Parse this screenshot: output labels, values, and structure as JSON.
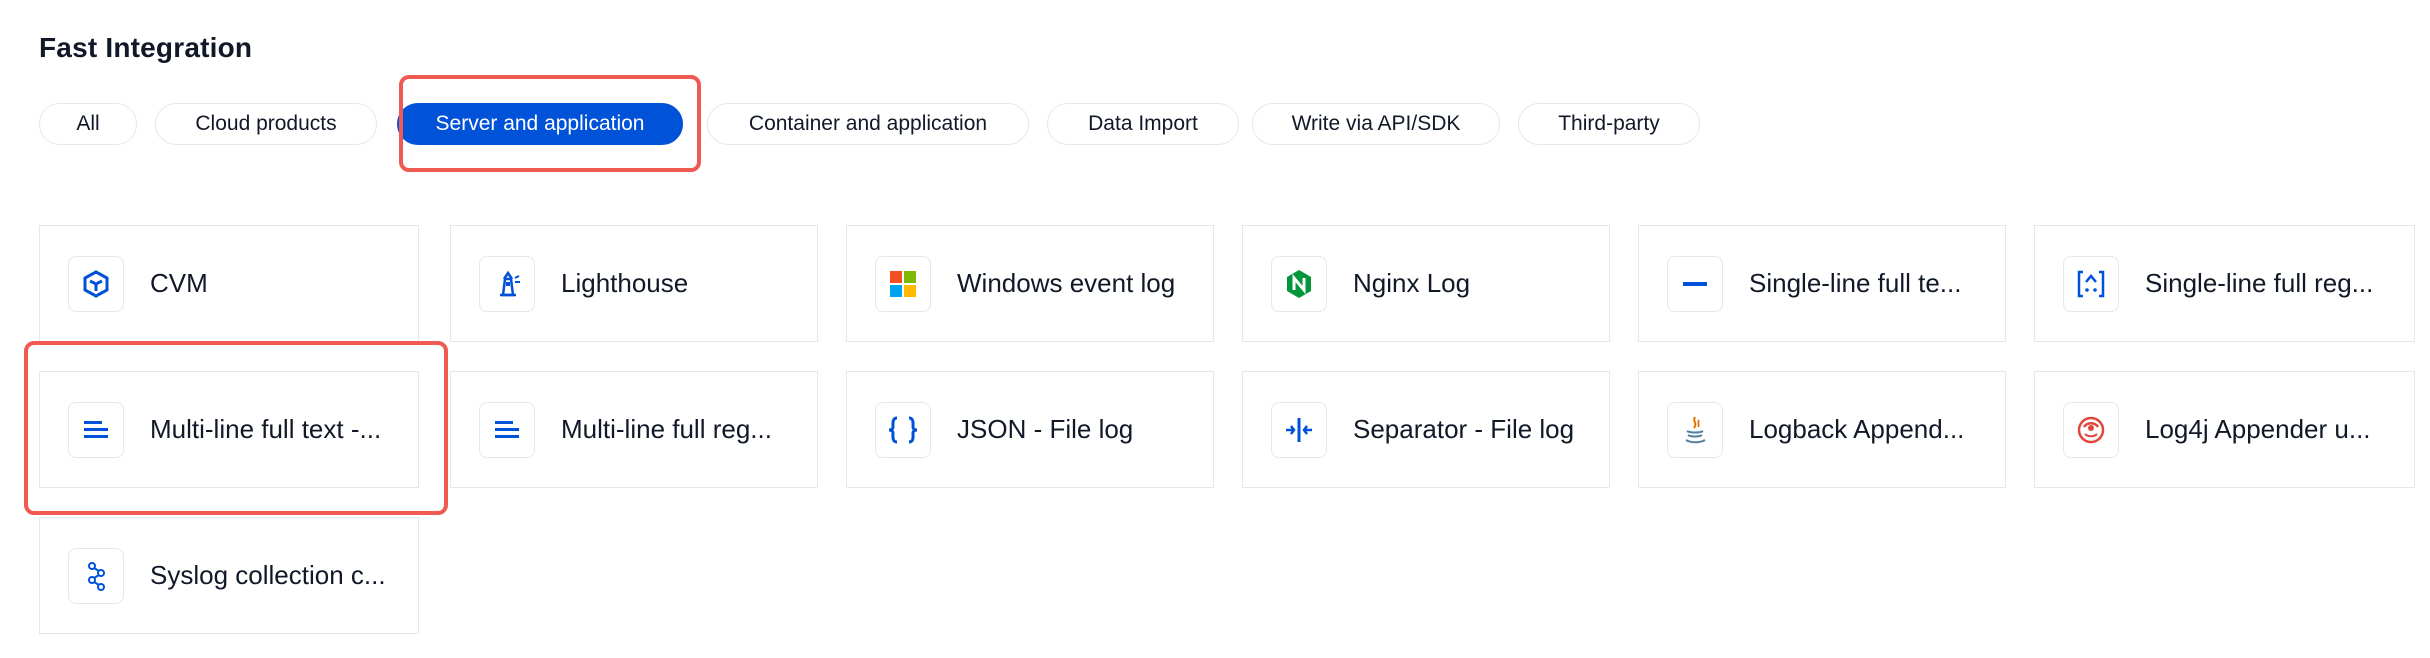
{
  "title": "Fast Integration",
  "filters": [
    {
      "label": "All",
      "active": false
    },
    {
      "label": "Cloud products",
      "active": false
    },
    {
      "label": "Server and application",
      "active": true
    },
    {
      "label": "Container and application",
      "active": false
    },
    {
      "label": "Data Import",
      "active": false
    },
    {
      "label": "Write via API/SDK",
      "active": false
    },
    {
      "label": "Third-party",
      "active": false
    }
  ],
  "cards": [
    {
      "label": "CVM",
      "icon": "cvm-icon"
    },
    {
      "label": "Lighthouse",
      "icon": "lighthouse-icon"
    },
    {
      "label": "Windows event log",
      "icon": "windows-logo-icon"
    },
    {
      "label": "Nginx Log",
      "icon": "nginx-logo-icon"
    },
    {
      "label": "Single-line full te...",
      "icon": "single-line-icon"
    },
    {
      "label": "Single-line full reg...",
      "icon": "regex-icon"
    },
    {
      "label": "Multi-line full text -...",
      "icon": "multi-line-icon"
    },
    {
      "label": "Multi-line full reg...",
      "icon": "multi-line-regex-icon"
    },
    {
      "label": "JSON - File log",
      "icon": "json-braces-icon"
    },
    {
      "label": "Separator - File log",
      "icon": "separator-icon"
    },
    {
      "label": "Logback Append...",
      "icon": "java-logo-icon"
    },
    {
      "label": "Log4j Appender u...",
      "icon": "log4j-logo-icon"
    },
    {
      "label": "Syslog collection c...",
      "icon": "syslog-icon"
    }
  ],
  "colors": {
    "accent": "#0052d9",
    "highlight": "#ef5a52",
    "border": "#e5e7eb"
  }
}
